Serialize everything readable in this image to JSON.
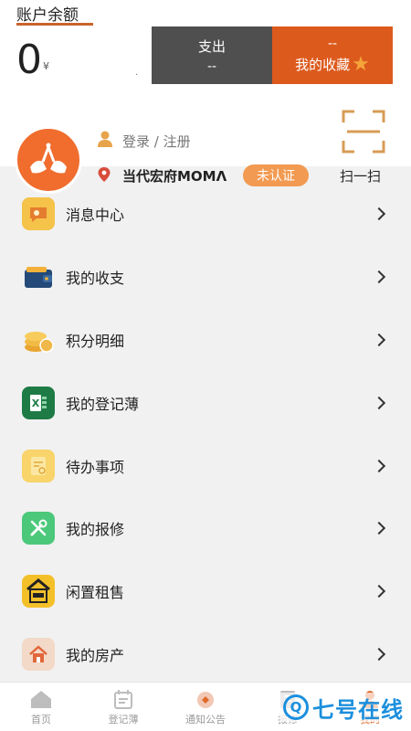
{
  "balance": {
    "label": "账户余额",
    "value": "0",
    "unit": "¥",
    "dot": "."
  },
  "summary": {
    "expense": {
      "title": "支出",
      "value": "--"
    },
    "favorites": {
      "value": "--",
      "title": "我的收藏",
      "icon": "star-icon"
    }
  },
  "user": {
    "login_text": "登录 / 注册",
    "community": "当代宏府MOMΛ",
    "badge": "未认证",
    "scan_label": "扫一扫"
  },
  "menu": [
    {
      "label": "消息中心",
      "icon": "message-icon",
      "color": "#f5c24a"
    },
    {
      "label": "我的收支",
      "icon": "wallet-icon",
      "color": "#ffffff"
    },
    {
      "label": "积分明细",
      "icon": "coins-icon",
      "color": "#ffffff"
    },
    {
      "label": "我的登记薄",
      "icon": "excel-icon",
      "color": "#1e7b45"
    },
    {
      "label": "待办事项",
      "icon": "todo-icon",
      "color": "#f8d46a"
    },
    {
      "label": "我的报修",
      "icon": "repair-icon",
      "color": "#4cc87a"
    },
    {
      "label": "闲置租售",
      "icon": "house-sale-icon",
      "color": "#f4c02a"
    },
    {
      "label": "我的房产",
      "icon": "property-icon",
      "color": "#f3d9c8"
    }
  ],
  "tabs": [
    {
      "label": "首页",
      "icon": "home-icon"
    },
    {
      "label": "登记薄",
      "icon": "register-icon"
    },
    {
      "label": "通知公告",
      "icon": "notice-icon"
    },
    {
      "label": "报修",
      "icon": "repair-tab-icon"
    },
    {
      "label": "我的",
      "icon": "profile-icon"
    }
  ],
  "watermark": {
    "text": "七号在线",
    "logo": "Q"
  }
}
